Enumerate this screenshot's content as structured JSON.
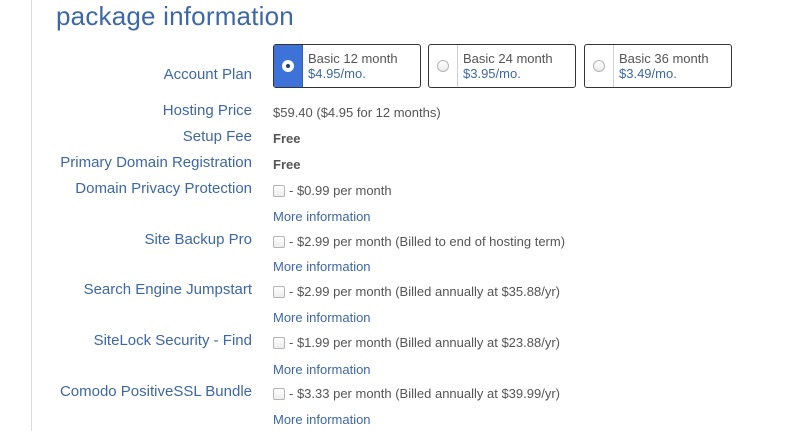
{
  "section": {
    "title": "package information"
  },
  "account_plan": {
    "label": "Account Plan",
    "options": [
      {
        "name": "Basic 12 month",
        "price": "$4.95/mo.",
        "selected": true
      },
      {
        "name": "Basic 24 month",
        "price": "$3.95/mo.",
        "selected": false
      },
      {
        "name": "Basic 36 month",
        "price": "$3.49/mo.",
        "selected": false
      }
    ]
  },
  "hosting_price": {
    "label": "Hosting Price",
    "value": "$59.40  ($4.95 for 12 months)"
  },
  "setup_fee": {
    "label": "Setup Fee",
    "value": "Free"
  },
  "primary_domain": {
    "label": "Primary Domain Registration",
    "value": "Free"
  },
  "extras": [
    {
      "label": "Domain Privacy Protection",
      "price": "- $0.99 per month",
      "more": "More information",
      "checked": false
    },
    {
      "label": "Site Backup Pro",
      "price": "- $2.99 per month (Billed to end of hosting term)",
      "more": "More information",
      "checked": false
    },
    {
      "label": "Search Engine Jumpstart",
      "price": "- $2.99 per month (Billed annually at $35.88/yr)",
      "more": "More information",
      "checked": false
    },
    {
      "label": "SiteLock Security - Find",
      "price": "- $1.99 per month (Billed annually at $23.88/yr)",
      "more": "More information",
      "checked": false
    },
    {
      "label": "Comodo PositiveSSL Bundle",
      "price": "- $3.33 per month (Billed annually at $39.99/yr)",
      "more": "More information",
      "checked": false
    }
  ],
  "colors": {
    "accent": "#3d67a8",
    "selected_plan": "#3d72d8",
    "text": "#555555"
  }
}
